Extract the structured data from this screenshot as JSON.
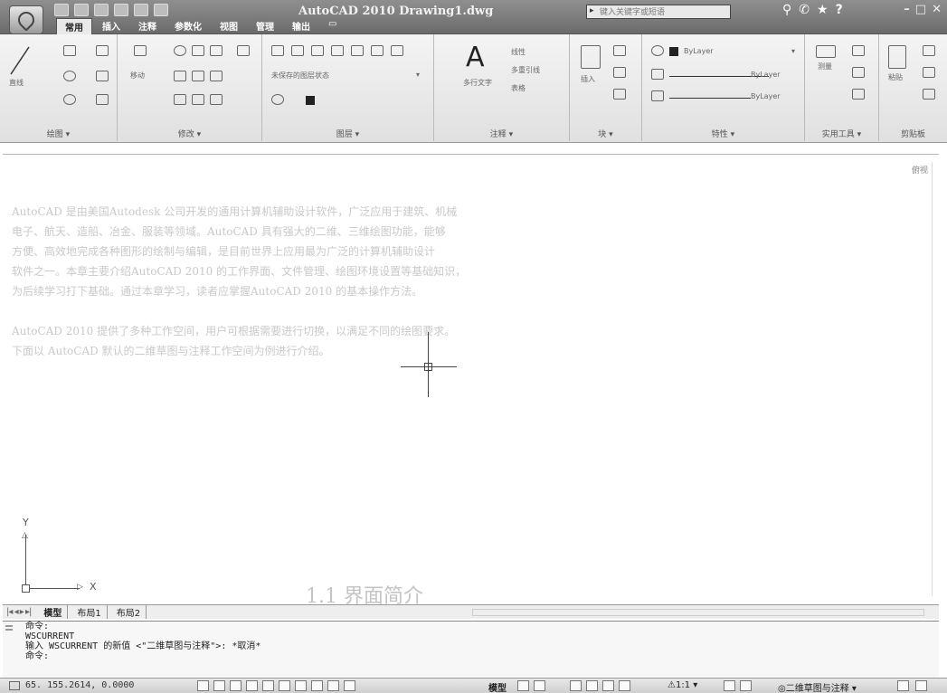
{
  "titlebar": {
    "app_title": "AutoCAD 2010  Drawing1.dwg",
    "search_placeholder": "键入关键字或短语",
    "window_controls": [
      "–",
      "□",
      "✕"
    ]
  },
  "ribbon_tabs": [
    {
      "label": "常用",
      "active": true
    },
    {
      "label": "插入",
      "active": false
    },
    {
      "label": "注释",
      "active": false
    },
    {
      "label": "参数化",
      "active": false
    },
    {
      "label": "视图",
      "active": false
    },
    {
      "label": "管理",
      "active": false
    },
    {
      "label": "输出",
      "active": false
    }
  ],
  "ribbon_panels": {
    "draw": {
      "title": "绘图 ▾",
      "line_label": "直线"
    },
    "modify": {
      "title": "修改 ▾",
      "move_label": "移动"
    },
    "layers": {
      "title": "图层 ▾",
      "state_label": "未保存的图层状态"
    },
    "annotation": {
      "title": "注释 ▾",
      "text_label": "多行文字",
      "linear_label": "线性",
      "multileader_label": "多重引线",
      "table_label": "表格"
    },
    "block": {
      "title": "块 ▾",
      "insert_label": "插入"
    },
    "properties": {
      "title": "特性 ▾",
      "bylayer_color": "ByLayer",
      "bylayer_linetype": "ByLayer",
      "bylayer_lineweight": "ByLayer"
    },
    "utilities": {
      "title": "实用工具 ▾",
      "measure_label": "测量"
    },
    "clipboard": {
      "title": "剪贴板",
      "paste_label": "粘贴"
    }
  },
  "drawing": {
    "viewcube_label": "俯视",
    "ucs_x": "X",
    "ucs_y": "Y",
    "bg_lines": [
      "AutoCAD 是由美国Autodesk 公司开发的通用计算机辅助设计软件，广泛应用于建筑、机械",
      "电子、航天、造船、冶金、服装等领域。AutoCAD 具有强大的二维、三维绘图功能，能够",
      "方便、高效地完成各种图形的绘制与编辑，是目前世界上应用最为广泛的计算机辅助设计",
      "软件之一。本章主要介绍AutoCAD 2010 的工作界面、文件管理、绘图环境设置等基础知识，",
      "为后续学习打下基础。通过本章学习，读者应掌握AutoCAD 2010 的基本操作方法。",
      "",
      "AutoCAD 2010 提供了多种工作空间，用户可根据需要进行切换，以满足不同的绘图要求。",
      "下面以 AutoCAD 默认的二维草图与注释工作空间为例进行介绍。"
    ],
    "bg_heading": "1.1  界面简介"
  },
  "layout_tabs": {
    "nav": "|◂ ◂ ▸ ▸|",
    "tabs": [
      "模型",
      "布局1",
      "布局2"
    ]
  },
  "command": {
    "lines": [
      "命令:",
      "WSCURRENT",
      "输入 WSCURRENT 的新值 <\"二维草图与注释\">: *取消*",
      "命令:"
    ]
  },
  "statusbar": {
    "coords": "65. 155.2614, 0.0000",
    "model_label": "模型",
    "scale_label": "⚠1:1 ▾",
    "workspace_label": "◎二维草图与注释 ▾"
  }
}
